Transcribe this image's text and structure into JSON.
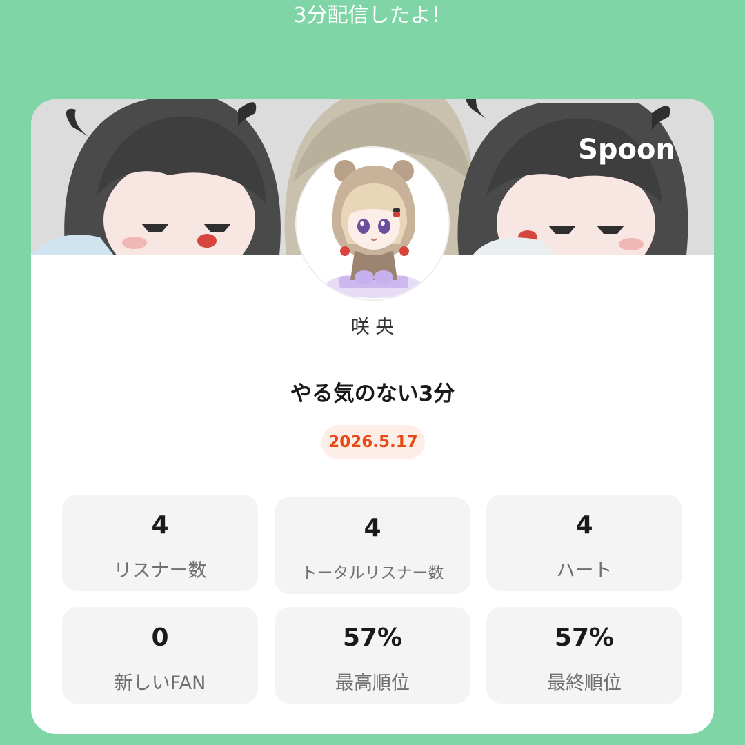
{
  "header": {
    "title": "3分配信したよ！"
  },
  "card": {
    "brand": "Spoon",
    "username": "咲 央",
    "stream_title": "やる気のない3分",
    "date": "2026.5.17",
    "accent_color": "#e84a16",
    "background_color": "#80d5a7"
  },
  "stats": [
    {
      "value": "4",
      "label": "リスナー数"
    },
    {
      "value": "4",
      "label": "トータルリスナー数"
    },
    {
      "value": "4",
      "label": "ハート"
    },
    {
      "value": "0",
      "label": "新しいFAN"
    },
    {
      "value": "57%",
      "label": "最高順位"
    },
    {
      "value": "57%",
      "label": "最終順位"
    }
  ]
}
